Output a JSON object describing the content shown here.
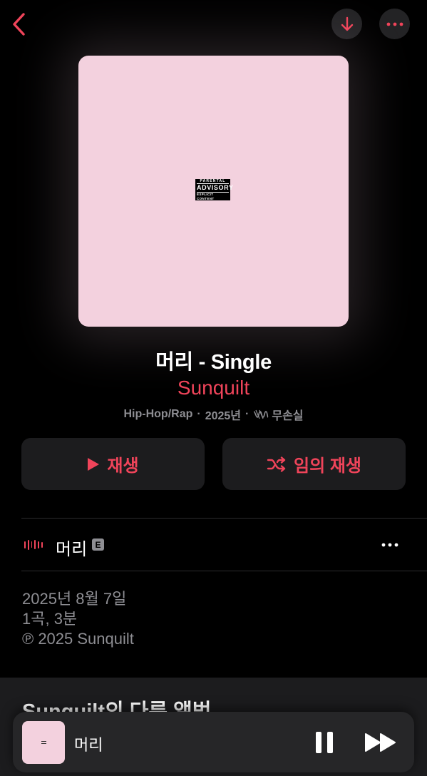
{
  "nav": {
    "back_icon": "chevron-left-icon",
    "download_icon": "arrow-down-icon",
    "more_icon": "ellipsis-icon"
  },
  "album": {
    "title": "머리 - Single",
    "artist": "Sunquilt",
    "genre": "Hip-Hop/Rap",
    "year": "2025년",
    "lossless": "무손실",
    "cover_color": "#f3d1de",
    "advisory": {
      "top": "PARENTAL",
      "middle": "ADVISORY",
      "bottom": "EXPLICIT CONTENT"
    }
  },
  "actions": {
    "play_label": "재생",
    "shuffle_label": "임의 재생"
  },
  "tracks": [
    {
      "title": "머리",
      "explicit": "E",
      "playing": true
    }
  ],
  "release_info": {
    "date": "2025년 8월 7일",
    "count_duration": "1곡, 3분",
    "copyright": "℗ 2025 Sunquilt"
  },
  "more_section": {
    "title": "Sunquilt의 다른 앨범"
  },
  "now_playing": {
    "title": "머리",
    "state": "playing"
  },
  "colors": {
    "accent": "#f0445a",
    "background": "#000000",
    "secondary_text": "#8e8e93",
    "card": "#1c1c1e"
  }
}
